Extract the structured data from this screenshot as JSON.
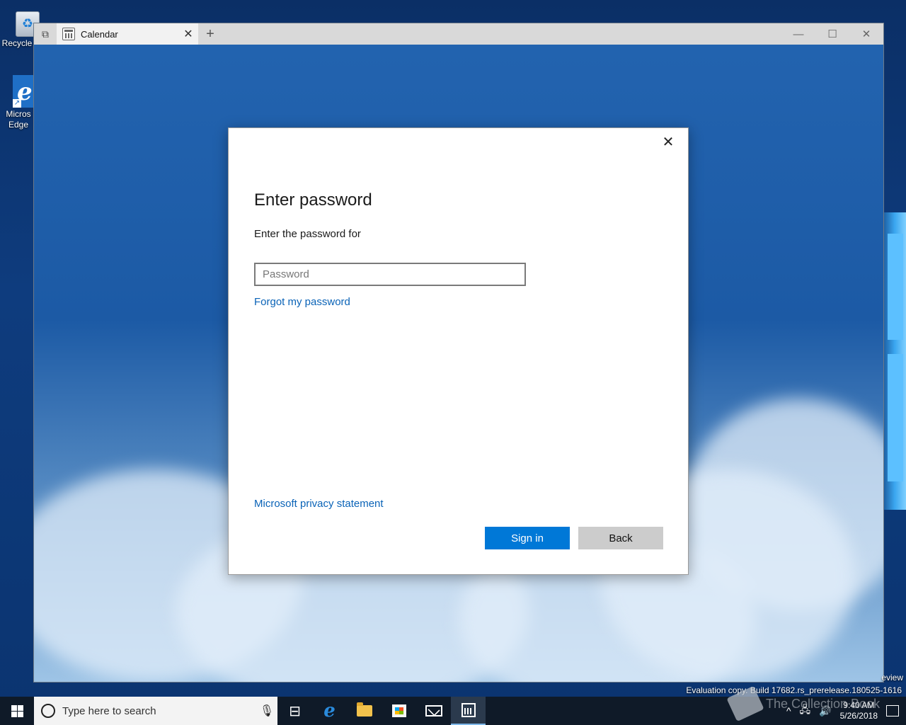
{
  "desktop": {
    "icons": [
      {
        "label": "Recycle"
      },
      {
        "label": "Micros Edge"
      }
    ]
  },
  "window": {
    "tab_title": "Calendar",
    "tab_close": "✕",
    "new_tab": "+",
    "minimize": "—",
    "maximize": "☐",
    "close": "✕"
  },
  "dialog": {
    "close": "✕",
    "title": "Enter password",
    "subtitle": "Enter the password for",
    "password_placeholder": "Password",
    "password_value": "",
    "forgot_link": "Forgot my password",
    "privacy_link": "Microsoft privacy statement",
    "sign_in_button": "Sign in",
    "back_button": "Back"
  },
  "watermark": {
    "eval_text": "Evaluation copy. Build 17682.rs_prerelease.180525-1616",
    "eval_view": "eview",
    "site": "The Collection Book"
  },
  "taskbar": {
    "search_placeholder": "Type here to search",
    "icons": [
      "task-view-icon",
      "edge-icon",
      "file-explorer-icon",
      "store-icon",
      "mail-icon",
      "calendar-icon"
    ],
    "time": "9:40 AM",
    "date": "5/26/2018"
  },
  "colors": {
    "accent": "#0078d7",
    "link": "#0a63b7",
    "taskbar": "#0f1a28"
  }
}
